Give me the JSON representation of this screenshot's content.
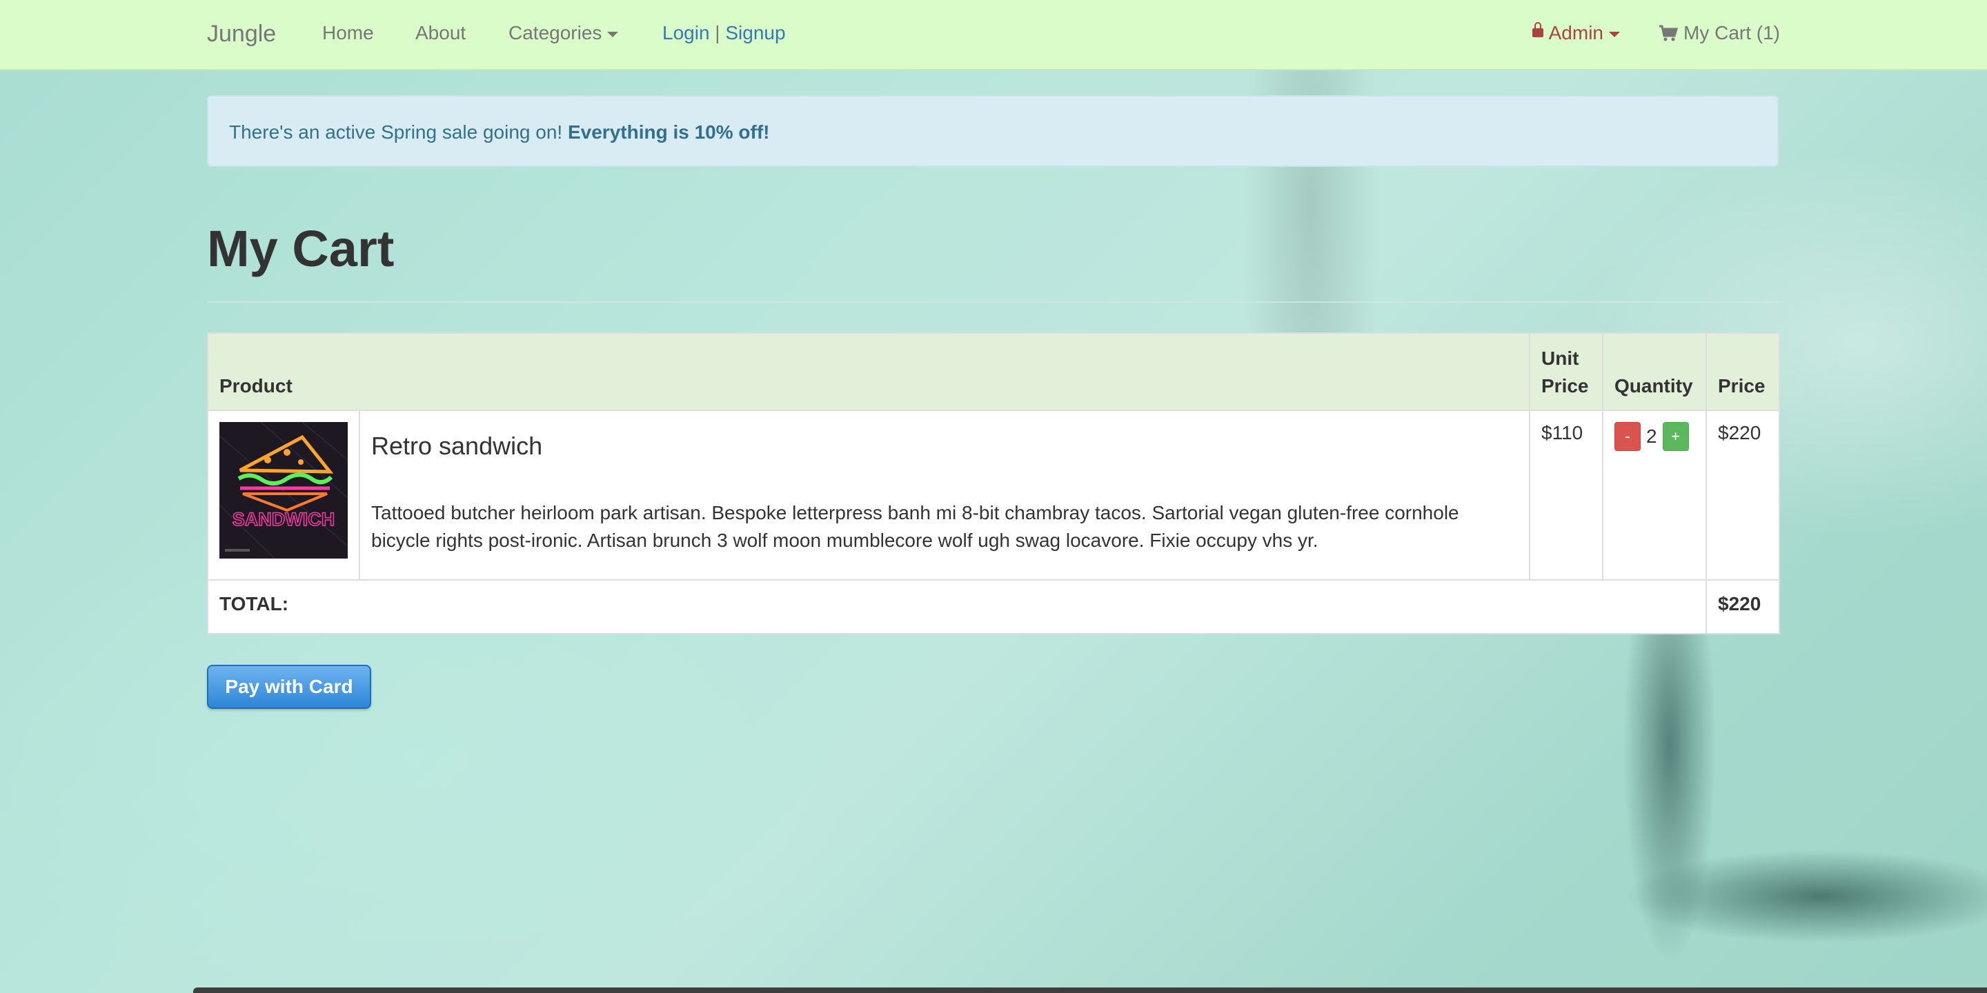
{
  "navbar": {
    "brand": "Jungle",
    "links": [
      "Home",
      "About",
      "Categories"
    ],
    "login": "Login",
    "separator": "|",
    "signup": "Signup",
    "admin": "Admin",
    "cart": "My Cart (1)"
  },
  "alert": {
    "text": "There's an active Spring sale going on!",
    "bold": "Everything is 10% off!"
  },
  "page_title": "My Cart",
  "table": {
    "headers": {
      "product": "Product",
      "unit_price_1": "Unit",
      "unit_price_2": "Price",
      "quantity": "Quantity",
      "price": "Price"
    },
    "items": [
      {
        "name": "Retro sandwich",
        "description": "Tattooed butcher heirloom park artisan. Bespoke letterpress banh mi 8-bit chambray tacos. Sartorial vegan gluten-free cornhole bicycle rights post-ironic. Artisan brunch 3 wolf moon mumblecore wolf ugh swag locavore. Fixie occupy vhs yr.",
        "image_text": "SANDWICH",
        "unit_price": "$110",
        "quantity": "2",
        "minus": "-",
        "plus": "+",
        "price": "$220"
      }
    ],
    "total_label": "TOTAL:",
    "total_value": "$220"
  },
  "pay_button": "Pay with Card",
  "colors": {
    "navbar_bg": "#d9fcc9",
    "alert_bg": "#d9ecf3",
    "alert_text": "#31708f",
    "admin_red": "#a94442",
    "link_blue": "#337ab7",
    "minus_red": "#d9534f",
    "plus_green": "#5cb85c",
    "header_bg": "#e2efd9"
  }
}
